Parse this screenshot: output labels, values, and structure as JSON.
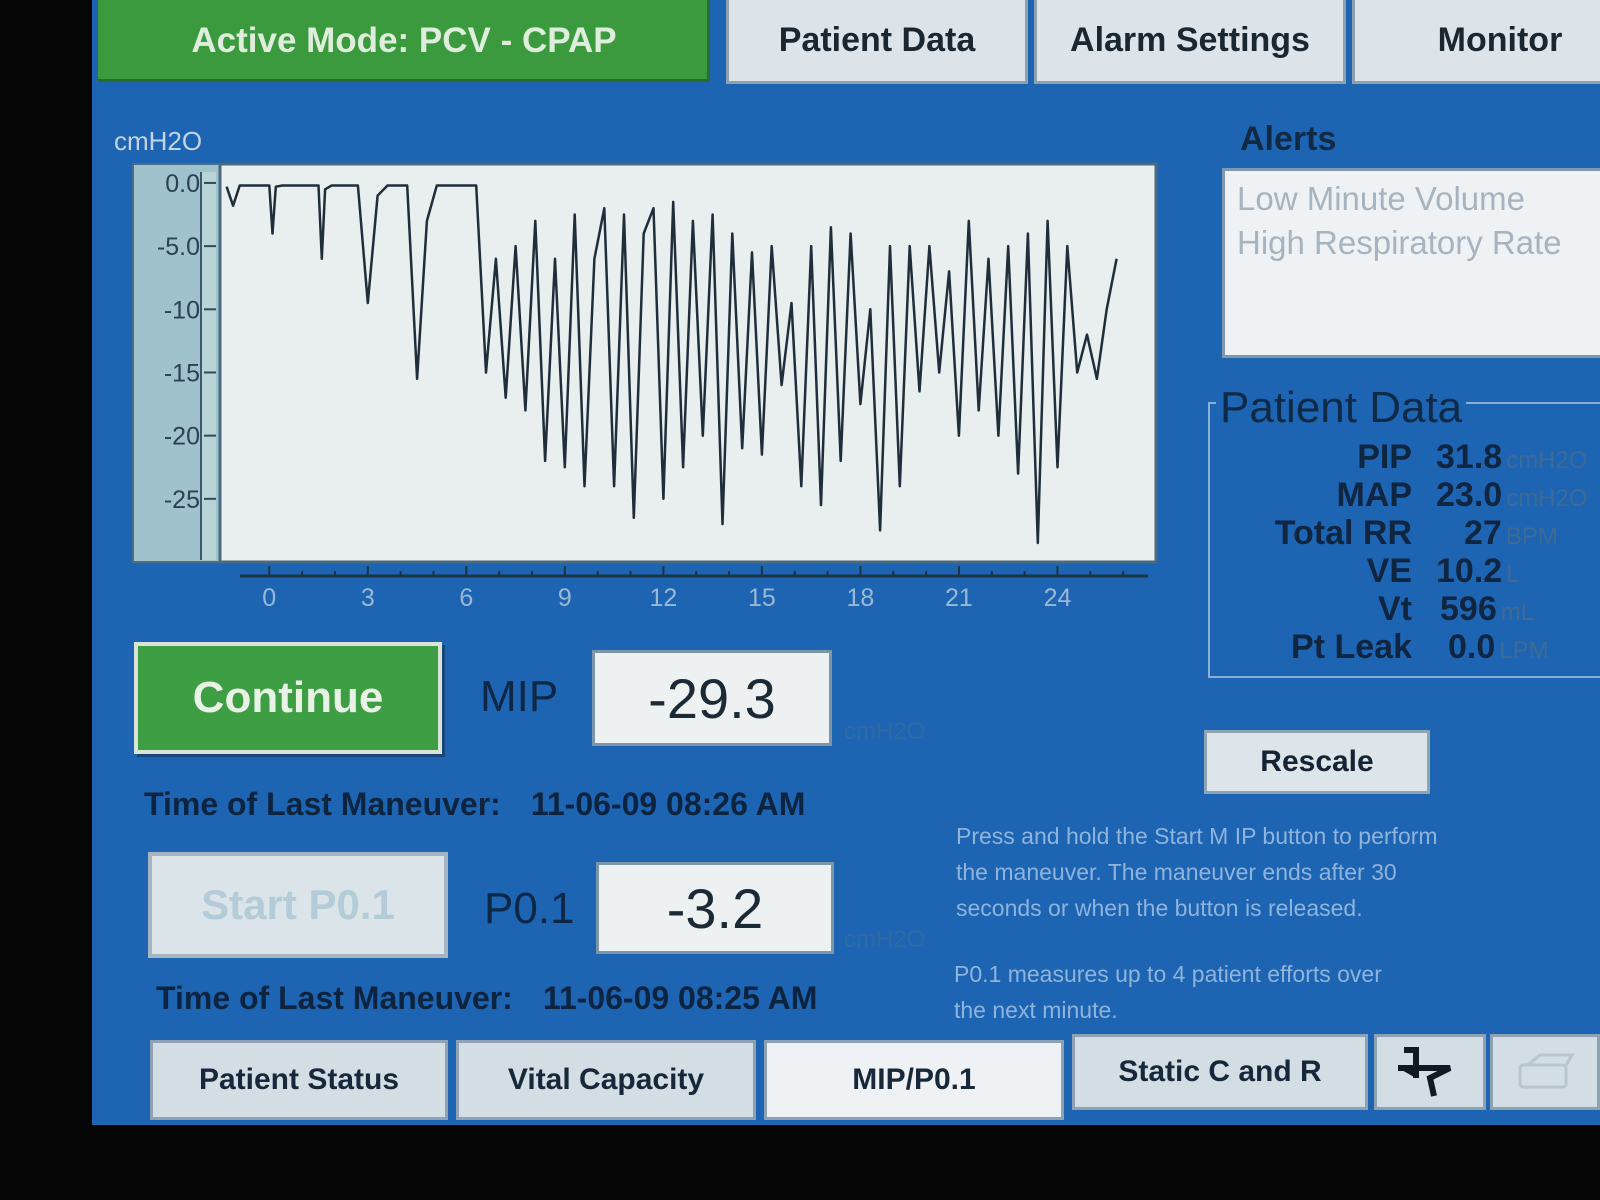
{
  "top_tabs": {
    "active_mode": "Active Mode:  PCV - CPAP",
    "patient_data": "Patient Data",
    "alarm_settings": "Alarm Settings",
    "monitor": "Monitor"
  },
  "alerts": {
    "title": "Alerts",
    "items": [
      "Low Minute Volume",
      "High Respiratory Rate"
    ]
  },
  "patient_data": {
    "title": "Patient Data",
    "rows": [
      {
        "label": "PIP",
        "value": "31.8",
        "unit": "cmH2O"
      },
      {
        "label": "MAP",
        "value": "23.0",
        "unit": "cmH2O"
      },
      {
        "label": "Total RR",
        "value": "27",
        "unit": "BPM"
      },
      {
        "label": "VE",
        "value": "10.2",
        "unit": "L"
      },
      {
        "label": "Vt",
        "value": "596",
        "unit": "mL"
      },
      {
        "label": "Pt Leak",
        "value": "0.0",
        "unit": "LPM"
      }
    ]
  },
  "mip": {
    "button": "Continue",
    "label": "MIP",
    "value": "-29.3",
    "unit": "cmH2O",
    "time_label": "Time of Last Maneuver:",
    "time_value": "11-06-09  08:26 AM"
  },
  "p01": {
    "button": "Start P0.1",
    "label": "P0.1",
    "value": "-3.2",
    "unit": "cmH2O",
    "time_label": "Time of Last Maneuver:",
    "time_value": "11-06-09  08:25 AM"
  },
  "rescale_label": "Rescale",
  "help": {
    "line1": "Press and hold the Start M IP button to perform",
    "line2": "the maneuver. The maneuver ends after 30",
    "line3": "seconds or when the button is released.",
    "line4": "P0.1 measures up to 4 patient efforts over",
    "line5": "the next minute."
  },
  "bottom_tabs": {
    "patient_status": "Patient Status",
    "vital_capacity": "Vital Capacity",
    "mip_p01": "MIP/P0.1",
    "static_c_r": "Static C and R"
  },
  "icons": [
    "waveform-freeze-icon",
    "settings-icon"
  ],
  "colors": {
    "screen_bg": "#1d64b2",
    "active_green": "#3b9a3e",
    "trace": "#1f2e3a"
  },
  "chart_data": {
    "type": "line",
    "ylabel": "cmH2O",
    "y_ticks": [
      "0.0",
      "-5.0",
      "-10",
      "-15",
      "-20",
      "-25"
    ],
    "x_ticks": [
      "0",
      "3",
      "6",
      "9",
      "12",
      "15",
      "18",
      "21",
      "24"
    ],
    "xlim": [
      -1.5,
      27
    ],
    "ylim": [
      -30,
      1.5
    ],
    "grid": false,
    "series": [
      {
        "x": [
          -1.3,
          -1.1,
          -0.9,
          -0.7,
          0.0,
          0.1,
          0.2,
          0.4,
          1.0,
          1.5,
          1.6,
          1.7,
          1.9,
          2.2,
          2.5,
          2.7,
          3.0,
          3.3,
          3.6,
          3.9,
          4.2,
          4.5,
          4.8,
          5.1,
          5.5,
          5.7,
          5.9,
          6.3,
          6.6,
          6.9,
          7.2,
          7.5,
          7.8,
          8.1,
          8.4,
          8.7,
          9.0,
          9.3,
          9.6,
          9.9,
          10.2,
          10.5,
          10.8,
          11.1,
          11.4,
          11.7,
          12.0,
          12.3,
          12.6,
          12.9,
          13.2,
          13.5,
          13.8,
          14.1,
          14.4,
          14.7,
          15.0,
          15.3,
          15.6,
          15.9,
          16.2,
          16.5,
          16.8,
          17.1,
          17.4,
          17.7,
          18.0,
          18.3,
          18.6,
          18.9,
          19.2,
          19.5,
          19.8,
          20.1,
          20.4,
          20.7,
          21.0,
          21.3,
          21.6,
          21.9,
          22.2,
          22.5,
          22.8,
          23.1,
          23.4,
          23.7,
          24.0,
          24.3,
          24.6,
          24.9,
          25.2,
          25.5,
          25.8
        ],
        "y": [
          -0.3,
          -1.8,
          -0.2,
          -0.2,
          -0.2,
          -4.0,
          -0.3,
          -0.2,
          -0.2,
          -0.2,
          -6.0,
          -0.5,
          -0.2,
          -0.2,
          -0.2,
          -0.2,
          -9.5,
          -1.0,
          -0.2,
          -0.2,
          -0.2,
          -15.5,
          -3.0,
          -0.2,
          -0.2,
          -0.2,
          -0.2,
          -0.2,
          -15.0,
          -6.0,
          -17.0,
          -5.0,
          -18.0,
          -3.0,
          -22.0,
          -6.0,
          -22.5,
          -2.5,
          -24.0,
          -6.0,
          -2.0,
          -24.0,
          -2.5,
          -26.5,
          -4.0,
          -2.0,
          -25.0,
          -1.5,
          -22.5,
          -3.0,
          -20.0,
          -2.5,
          -27.0,
          -4.0,
          -21.0,
          -5.5,
          -21.5,
          -5.0,
          -16.0,
          -9.5,
          -24.0,
          -5.0,
          -25.5,
          -3.5,
          -22.0,
          -4.0,
          -17.5,
          -10.0,
          -27.5,
          -5.0,
          -24.0,
          -5.0,
          -16.5,
          -5.0,
          -15.0,
          -7.0,
          -20.0,
          -3.0,
          -18.0,
          -6.0,
          -20.0,
          -5.0,
          -23.0,
          -4.0,
          -28.5,
          -3.0,
          -22.5,
          -5.0,
          -15.0,
          -12.0,
          -15.5,
          -10.0,
          -6.0
        ]
      }
    ]
  }
}
